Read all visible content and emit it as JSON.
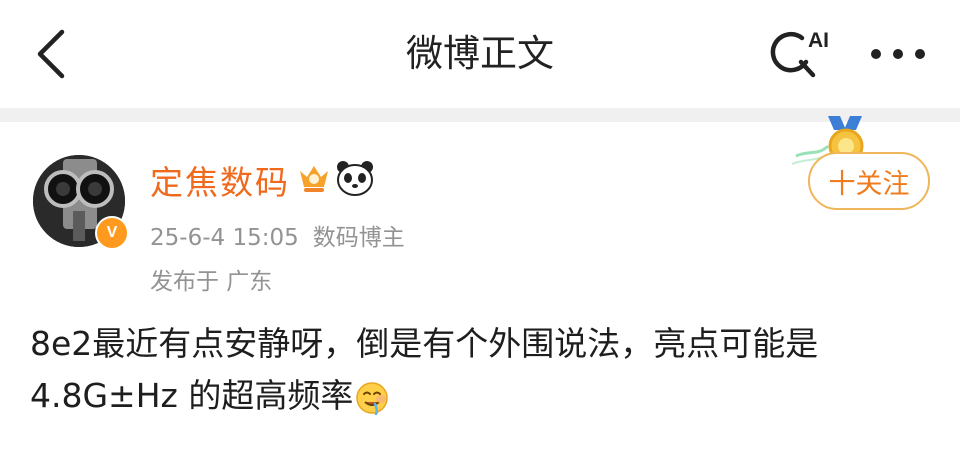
{
  "header": {
    "title": "微博正文",
    "ai_search_label": "AI",
    "back_icon": "chevron-left-icon",
    "more_icon": "more-dots-icon"
  },
  "post": {
    "author": {
      "name": "定焦数码",
      "verified_badge": "V",
      "badges": [
        "crown-badge-icon",
        "panda-badge-icon"
      ]
    },
    "timestamp": "25-6-4 15:05",
    "author_role": "数码博主",
    "location": "发布于 广东",
    "follow_label": "十关注",
    "text_line1": "8e2最近有点安静呀，倒是有个外围说法，亮点可能是",
    "text_line2": "4.8G±Hz 的超高频率",
    "emoji": "drooling-face-emoji"
  },
  "colors": {
    "accent_orange": "#f06a1d",
    "follow_border": "#f0b65a",
    "meta_gray": "#939393",
    "divider": "#f0f0f0"
  }
}
